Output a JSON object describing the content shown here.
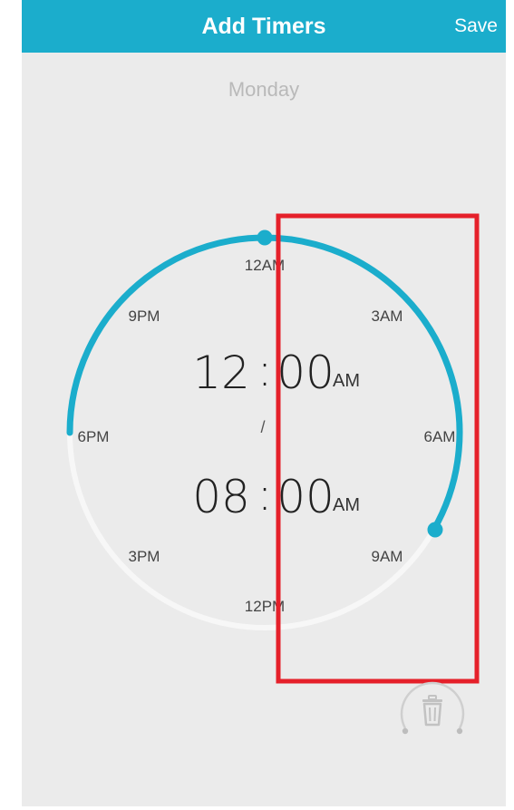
{
  "header": {
    "title": "Add Timers",
    "save_label": "Save"
  },
  "day": "Monday",
  "dial": {
    "hour_labels": {
      "h12am": "12AM",
      "h3am": "3AM",
      "h6am": "6AM",
      "h9am": "9AM",
      "h12pm": "12PM",
      "h3pm": "3PM",
      "h6pm": "6PM",
      "h9pm": "9PM"
    },
    "start": {
      "hour": "12",
      "colon": ":",
      "minute": "00",
      "ampm": "AM"
    },
    "separator": "/",
    "end": {
      "hour": "08",
      "colon": ":",
      "minute": "00",
      "ampm": "AM"
    },
    "range_color": "#1badcc",
    "track_color": "#f7f7f7"
  },
  "icons": {
    "delete": "trash-icon"
  },
  "colors": {
    "accent": "#1badcc",
    "background": "#ebebeb",
    "highlight_box": "#e5202a"
  }
}
